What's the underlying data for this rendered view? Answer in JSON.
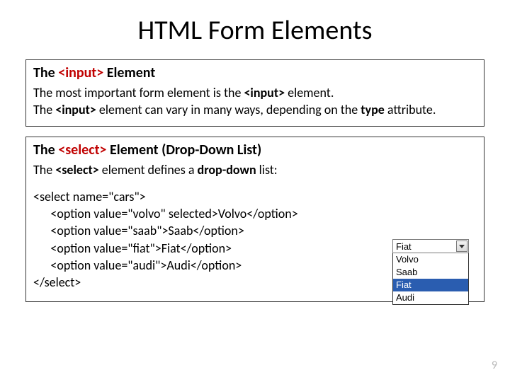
{
  "title": "HTML Form Elements",
  "box1": {
    "heading_pre": "The ",
    "heading_kw": "<input>",
    "heading_post": " Element",
    "line1_pre": "The most important form element is the ",
    "line1_kw": "<input>",
    "line1_post": " element.",
    "line2_pre": "The ",
    "line2_kw": "<input>",
    "line2_mid": " element can vary in many ways, depending on the ",
    "line2_kw2": "type",
    "line2_post": " attribute."
  },
  "box2": {
    "heading_pre": "The ",
    "heading_kw": "<select>",
    "heading_post": " Element (Drop-Down List)",
    "line1_pre": "The ",
    "line1_kw": "<select>",
    "line1_mid": " element defines a ",
    "line1_kw2": "drop-down",
    "line1_post": " list:",
    "code": "<select name=\"cars\">\n      <option value=\"volvo\" selected>Volvo</option>\n      <option value=\"saab\">Saab</option>\n      <option value=\"fiat\">Fiat</option>\n      <option value=\"audi\">Audi</option>\n</select>"
  },
  "dropdown": {
    "selected": "Fiat",
    "options": [
      "Volvo",
      "Saab",
      "Fiat",
      "Audi"
    ],
    "highlighted": "Fiat"
  },
  "page": "9",
  "colors": {
    "keyword": "#c00000",
    "highlight_bg": "#2a5db0"
  }
}
